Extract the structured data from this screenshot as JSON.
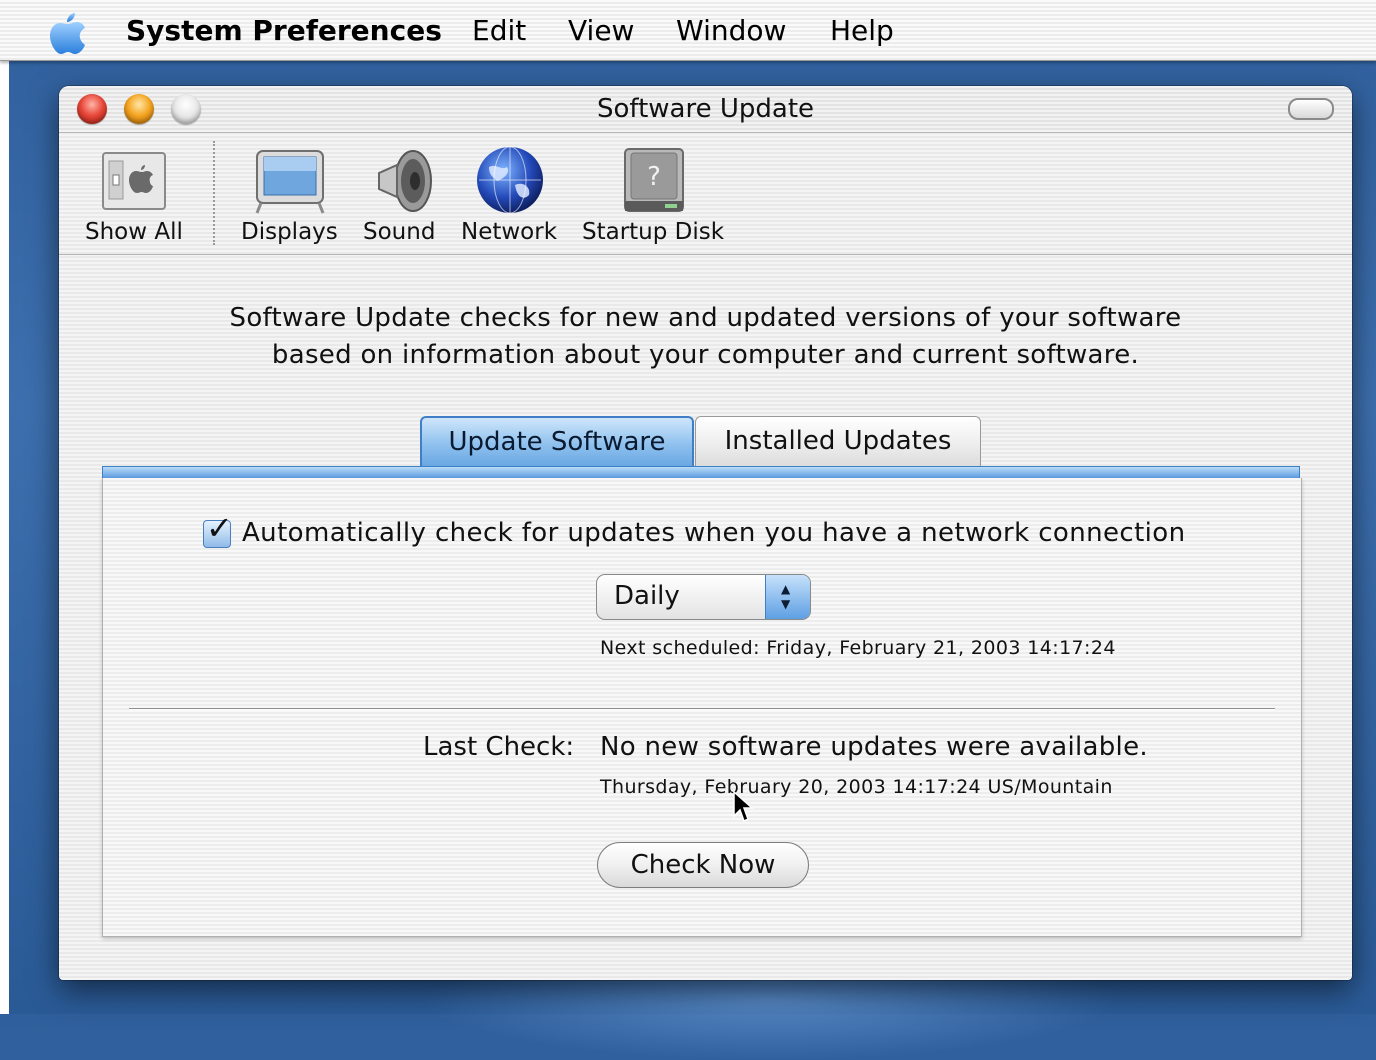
{
  "menubar": {
    "app_name": "System Preferences",
    "items": [
      "Edit",
      "View",
      "Window",
      "Help"
    ]
  },
  "window": {
    "title": "Software Update"
  },
  "toolbar": {
    "items": [
      {
        "label": "Show All",
        "icon": "show-all-icon"
      },
      {
        "label": "Displays",
        "icon": "display-icon"
      },
      {
        "label": "Sound",
        "icon": "speaker-icon"
      },
      {
        "label": "Network",
        "icon": "globe-icon"
      },
      {
        "label": "Startup Disk",
        "icon": "hard-disk-icon"
      }
    ]
  },
  "intro": {
    "line1": "Software Update checks for new and updated versions of your software",
    "line2": "based on information about your computer and current software."
  },
  "tabs": [
    {
      "label": "Update Software",
      "active": true
    },
    {
      "label": "Installed Updates",
      "active": false
    }
  ],
  "update_panel": {
    "auto_check_label": "Automatically check for updates when you have a network connection",
    "auto_check_checked": true,
    "frequency_selected": "Daily",
    "next_scheduled": "Next scheduled: Friday, February 21, 2003 14:17:24",
    "last_check_label": "Last Check:",
    "last_check_status": "No new software updates were available.",
    "last_check_date": "Thursday, February 20, 2003 14:17:24 US/Mountain",
    "check_now_label": "Check Now"
  },
  "colors": {
    "accent_blue": "#6aa7e2",
    "close_red": "#e8493a",
    "minimize_yellow": "#f5a623",
    "desktop_blue": "#3d6fae"
  }
}
